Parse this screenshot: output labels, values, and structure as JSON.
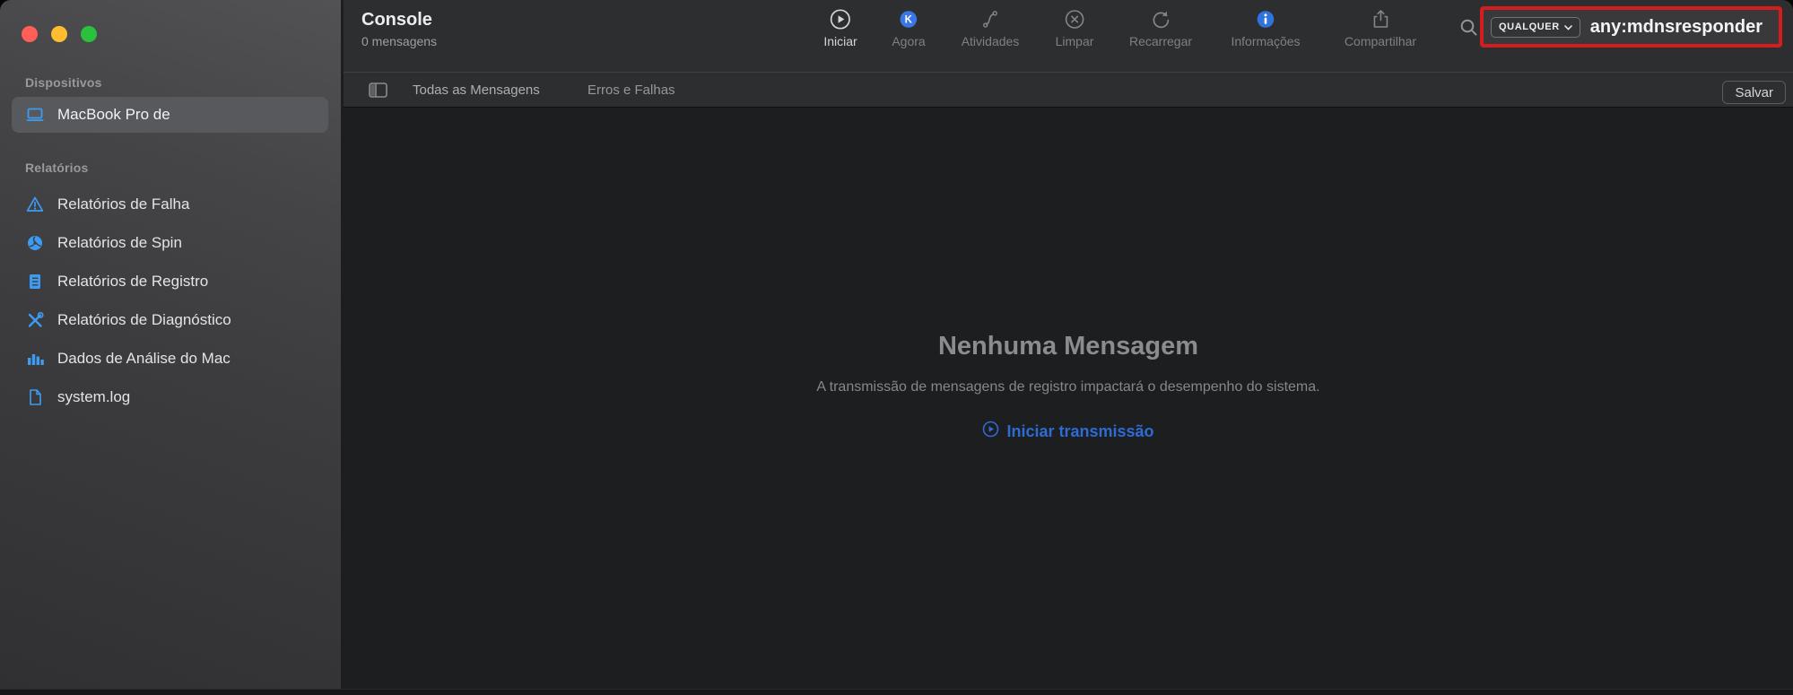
{
  "sidebar": {
    "sections": [
      {
        "header": "Dispositivos",
        "items": [
          {
            "label": "MacBook Pro de",
            "icon": "laptop-icon",
            "selected": true
          }
        ]
      },
      {
        "header": "Relatórios",
        "items": [
          {
            "label": "Relatórios de Falha",
            "icon": "warning-icon"
          },
          {
            "label": "Relatórios de Spin",
            "icon": "fan-icon"
          },
          {
            "label": "Relatórios de Registro",
            "icon": "list-document-icon"
          },
          {
            "label": "Relatórios de Diagnóstico",
            "icon": "tools-icon"
          },
          {
            "label": "Dados de Análise do Mac",
            "icon": "bar-chart-icon"
          },
          {
            "label": "system.log",
            "icon": "document-icon"
          }
        ]
      }
    ]
  },
  "toolbar": {
    "title": "Console",
    "subtitle": "0 mensagens",
    "buttons": [
      {
        "label": "Iniciar",
        "icon": "play-circle-icon"
      },
      {
        "label": "Agora",
        "icon": "now-icon"
      },
      {
        "label": "Atividades",
        "icon": "activities-icon"
      },
      {
        "label": "Limpar",
        "icon": "clear-icon"
      },
      {
        "label": "Recarregar",
        "icon": "reload-icon"
      },
      {
        "label": "Informações",
        "icon": "info-icon"
      },
      {
        "label": "Compartilhar",
        "icon": "share-icon"
      }
    ],
    "search": {
      "token": "QUALQUER",
      "query": "any:mdnsresponder"
    }
  },
  "filterbar": {
    "tabs": [
      "Todas as Mensagens",
      "Erros e Falhas"
    ],
    "save_label": "Salvar"
  },
  "content": {
    "empty_title": "Nenhuma Mensagem",
    "empty_subtitle": "A transmissão de mensagens de registro impactará o desempenho do sistema.",
    "action_label": "Iniciar transmissão"
  },
  "colors": {
    "sidebar_icon_blue": "#3d9bf2",
    "badge_blue": "#3a76e4",
    "link_blue": "#2e6bd4",
    "annotation_red": "#d61d1d",
    "selected_row": "#58595c"
  }
}
